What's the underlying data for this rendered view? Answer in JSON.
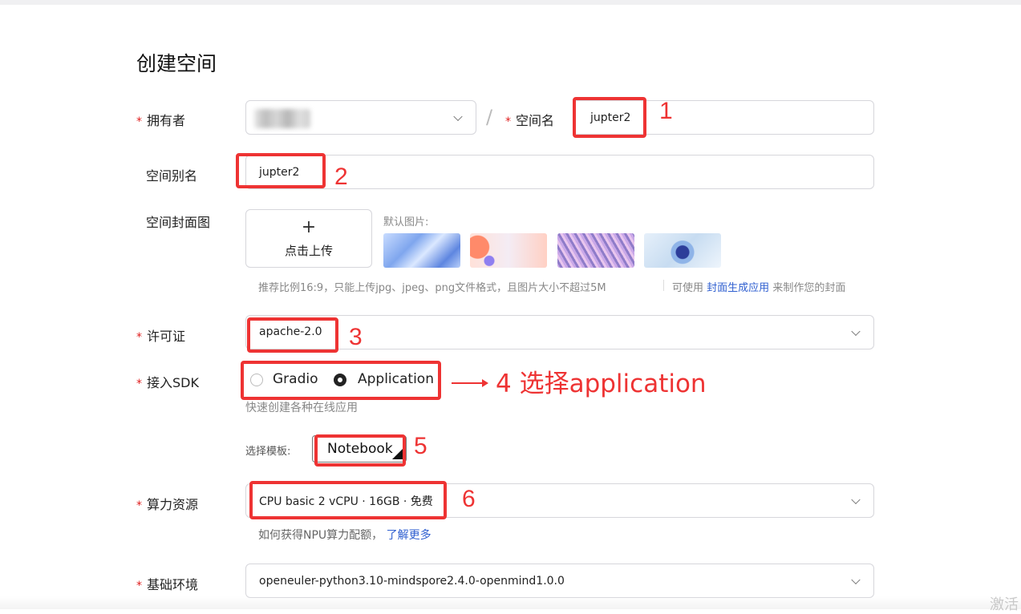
{
  "page": {
    "title": "创建空间"
  },
  "owner": {
    "label": "拥有者"
  },
  "space_name": {
    "label": "空间名",
    "value": "jupter2",
    "annotation": "1"
  },
  "alias": {
    "label": "空间别名",
    "value": "jupter2",
    "annotation": "2"
  },
  "cover": {
    "label": "空间封面图",
    "upload_label": "点击上传",
    "defaults_label": "默认图片:",
    "hint": "推荐比例16:9，只能上传jpg、jpeg、png文件格式，且图片大小不超过5M",
    "hint_prefix": "可使用",
    "hint_link": "封面生成应用",
    "hint_suffix": "来制作您的封面"
  },
  "license": {
    "label": "许可证",
    "value": "apache-2.0",
    "annotation": "3"
  },
  "sdk": {
    "label": "接入SDK",
    "options": [
      "Gradio",
      "Application"
    ],
    "selected": "Application",
    "hint": "快速创建各种在线应用",
    "annotation": "4 选择application"
  },
  "template": {
    "label": "选择模板:",
    "value": "Notebook",
    "annotation": "5"
  },
  "compute": {
    "label": "算力资源",
    "value": "CPU basic 2 vCPU · 16GB · 免费",
    "hint": "如何获得NPU算力配额，",
    "hint_link": "了解更多",
    "annotation": "6"
  },
  "base_env": {
    "label": "基础环境",
    "value": "openeuler-python3.10-mindspore2.4.0-openmind1.0.0"
  },
  "watermark": "激活",
  "colors": {
    "required": "#e02020",
    "annotation": "#ee3333",
    "link": "#2f5fd0"
  }
}
